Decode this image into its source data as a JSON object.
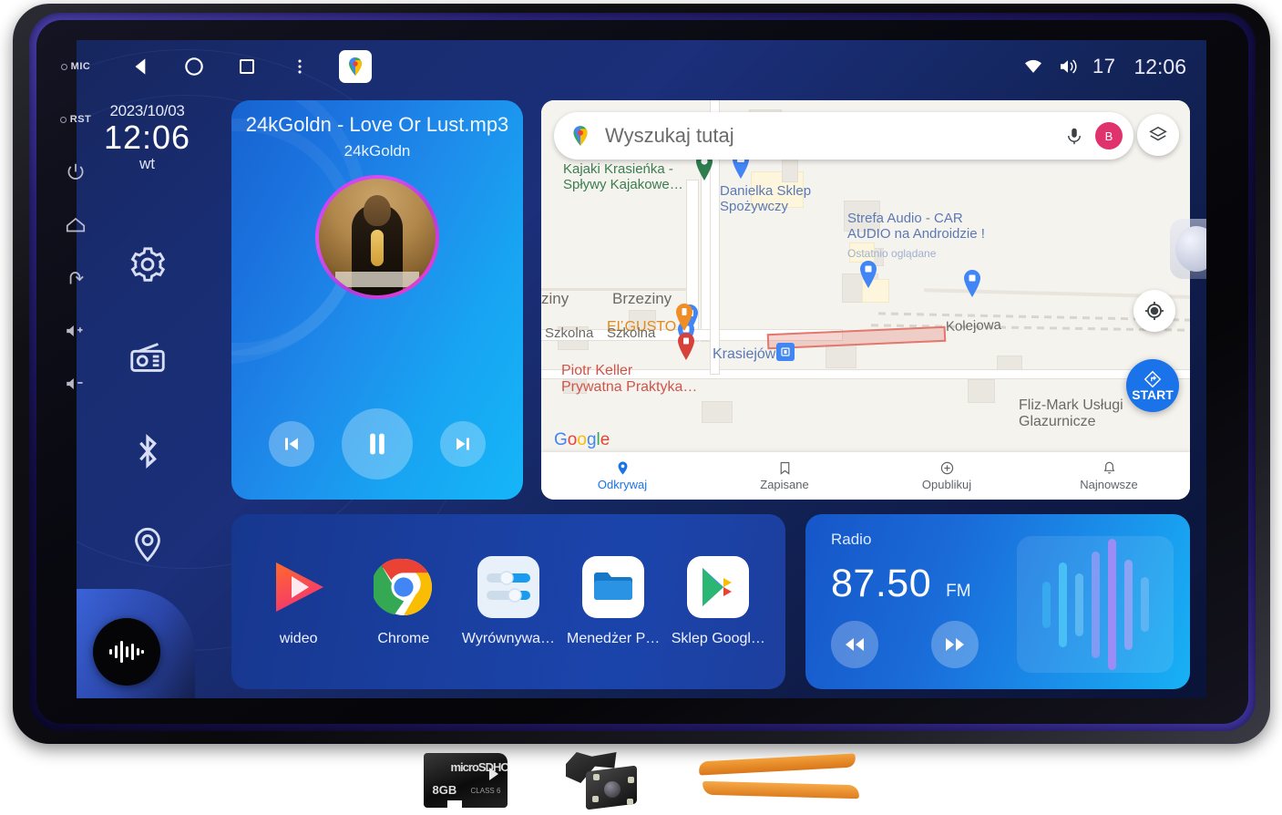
{
  "device": {
    "hardware_buttons": [
      {
        "name": "mic",
        "label": "MIC"
      },
      {
        "name": "reset",
        "label": "RST"
      },
      {
        "name": "power",
        "label": ""
      },
      {
        "name": "home",
        "label": ""
      },
      {
        "name": "back",
        "label": ""
      },
      {
        "name": "volume-up",
        "label": ""
      },
      {
        "name": "volume-down",
        "label": ""
      }
    ]
  },
  "statusbar": {
    "back_icon": "back-triangle-icon",
    "home_icon": "home-circle-icon",
    "recents_icon": "recents-square-icon",
    "overflow_icon": "more-vertical-icon",
    "app_chip_icon": "google-maps-icon",
    "wifi_icon": "wifi-icon",
    "volume_icon": "volume-icon",
    "volume_level": "17",
    "clock": "12:06"
  },
  "sidebar": {
    "date": "2023/10/03",
    "time": "12:06",
    "weekday": "wt",
    "items": [
      {
        "name": "settings",
        "icon": "gear-icon"
      },
      {
        "name": "radio",
        "icon": "radio-icon"
      },
      {
        "name": "bluetooth",
        "icon": "bluetooth-icon"
      },
      {
        "name": "navigation",
        "icon": "location-pin-icon"
      }
    ],
    "music_fab_icon": "audio-waveform-icon"
  },
  "player": {
    "title": "24kGoldn - Love Or Lust.mp3",
    "artist": "24kGoldn",
    "prev_icon": "skip-previous-icon",
    "play_pause_icon": "pause-icon",
    "next_icon": "skip-next-icon"
  },
  "map": {
    "search_placeholder": "Wyszukaj tutaj",
    "search_pin_icon": "google-maps-pin-icon",
    "mic_icon": "microphone-icon",
    "avatar_initial": "B",
    "layers_icon": "map-layers-icon",
    "locate_icon": "my-location-icon",
    "start_label": "START",
    "start_icon": "navigation-arrow-icon",
    "watermark": "Google",
    "labels": [
      {
        "text": "Kajaki Krasieńka -\nSpływy Kajakowe…",
        "color": "green"
      },
      {
        "text": "Danielka Sklep\nSpożywczy",
        "color": "blue"
      },
      {
        "text": "Strefa Audio - CAR\nAUDIO na Androidzie !",
        "color": "blue"
      },
      {
        "text": "Ostatnio oglądane",
        "color": "sub"
      },
      {
        "text": "EĽGUSTO",
        "color": "orange"
      },
      {
        "text": "Brzeziny",
        "color": "grey"
      },
      {
        "text": "ziny",
        "color": "grey"
      },
      {
        "text": "Szkolna",
        "color": "grey"
      },
      {
        "text": "Szkolna",
        "color": "grey"
      },
      {
        "text": "Piotr Keller\nPrywatna Praktyka…",
        "color": "red"
      },
      {
        "text": "Krasiejów",
        "color": "blue"
      },
      {
        "text": "Kolejowa",
        "color": "grey"
      },
      {
        "text": "Fliz-Mark Usługi\nGlazurnicze",
        "color": "grey"
      }
    ],
    "nav": [
      {
        "label": "Odkrywaj",
        "icon": "explore-pin-icon",
        "active": true
      },
      {
        "label": "Zapisane",
        "icon": "bookmark-icon",
        "active": false
      },
      {
        "label": "Opublikuj",
        "icon": "plus-circle-icon",
        "active": false
      },
      {
        "label": "Najnowsze",
        "icon": "bell-icon",
        "active": false
      }
    ]
  },
  "dock": {
    "apps": [
      {
        "label": "wideo",
        "icon": "video-player-icon"
      },
      {
        "label": "Chrome",
        "icon": "chrome-icon"
      },
      {
        "label": "Wyrównywa…",
        "icon": "equalizer-settings-icon"
      },
      {
        "label": "Menedżer P…",
        "icon": "file-manager-icon"
      },
      {
        "label": "Sklep Googl…",
        "icon": "google-play-icon"
      }
    ]
  },
  "radio": {
    "title": "Radio",
    "frequency": "87.50",
    "band": "FM",
    "seek_down_icon": "rewind-icon",
    "seek_up_icon": "fast-forward-icon",
    "visualizer_icon": "equalizer-bars-icon",
    "visualizer_bars": [
      34,
      62,
      46,
      78,
      96,
      66,
      40
    ]
  },
  "accessories": [
    {
      "name": "microsd-card",
      "capacity": "8GB",
      "logo": "microSDHC",
      "class_label": "CLASS 6"
    },
    {
      "name": "rear-view-camera",
      "capacity": "",
      "logo": "",
      "class_label": ""
    },
    {
      "name": "pry-tools",
      "capacity": "",
      "logo": "",
      "class_label": ""
    }
  ]
}
